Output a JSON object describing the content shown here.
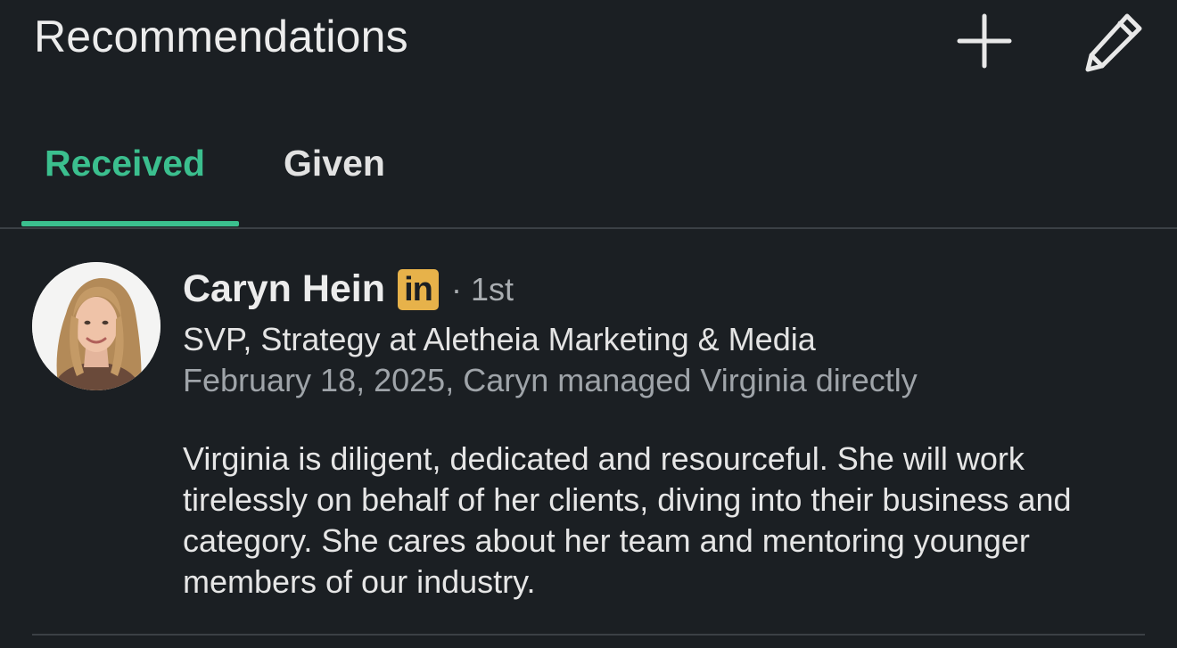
{
  "header": {
    "title": "Recommendations",
    "add_icon": "plus-icon",
    "edit_icon": "pencil-icon"
  },
  "tabs": [
    {
      "label": "Received",
      "active": true
    },
    {
      "label": "Given",
      "active": false
    }
  ],
  "colors": {
    "background": "#1b1f23",
    "accent": "#3bbf8e",
    "badge": "#e7b24a",
    "divider": "#3b4045"
  },
  "recommendation": {
    "name": "Caryn Hein",
    "badge": "in",
    "degree": "· 1st",
    "headline": "SVP, Strategy at Aletheia Marketing & Media",
    "meta": "February 18, 2025, Caryn managed Virginia directly",
    "text": "Virginia is diligent, dedicated and resourceful. She will work tirelessly on behalf of her clients, diving into their business and category. She cares about her team and mentoring younger members of our industry."
  }
}
